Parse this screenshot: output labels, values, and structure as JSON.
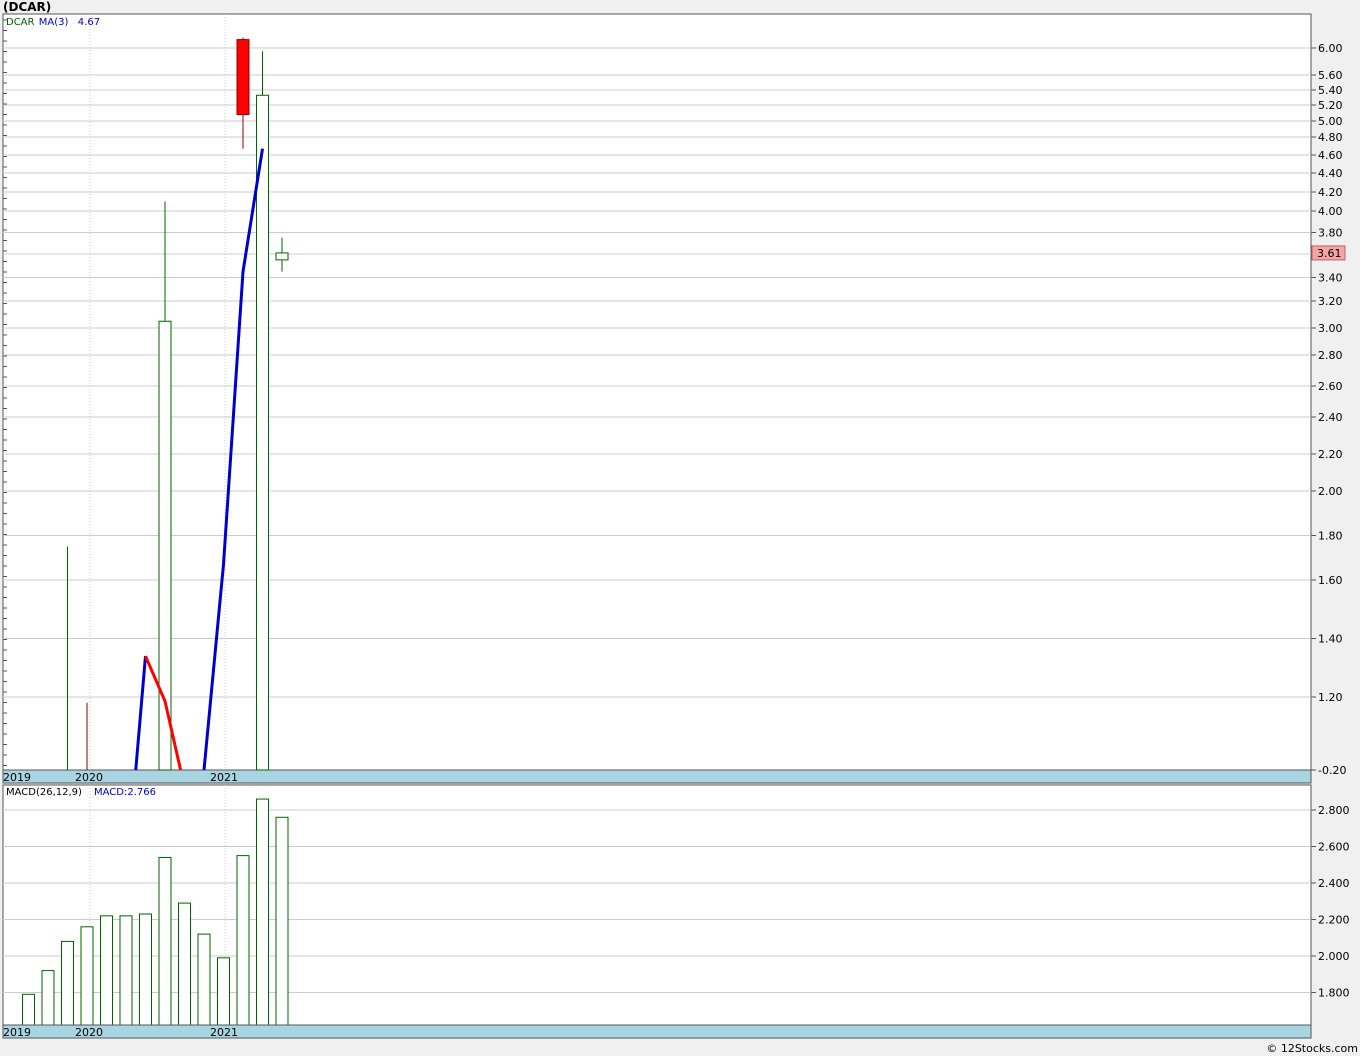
{
  "title": "(DCAR)",
  "credit": "© 12Stocks.com",
  "colors": {
    "background": "#ffffff",
    "axis_band": "#a9d5e3",
    "up": "#006400",
    "down": "#ff0000",
    "ma": "#0000cc",
    "last_price_box": "#f4a6a6",
    "grid": "#cccccc"
  },
  "chart_data": [
    {
      "type": "candlestick",
      "legend": [
        {
          "text": "DCAR",
          "color": "#006400"
        },
        {
          "text": "MA(3)",
          "color": "#0000cc"
        },
        {
          "text": "4.67",
          "color": "#0000cc"
        }
      ],
      "y_ticks": [
        "6.00",
        "5.60",
        "5.40",
        "5.20",
        "5.00",
        "4.80",
        "4.60",
        "4.40",
        "4.20",
        "4.00",
        "3.80",
        "3.60",
        "3.40",
        "3.20",
        "3.00",
        "2.80",
        "2.60",
        "2.40",
        "2.20",
        "2.00",
        "1.80",
        "1.60",
        "1.40",
        "1.20",
        "-0.20"
      ],
      "x_labels": [
        "2019",
        "2020",
        "2021"
      ],
      "last_price": "3.61",
      "candles": [
        {
          "high": 1.75,
          "low": -0.2,
          "open": -0.2,
          "close": -0.2,
          "dir": "up"
        },
        {
          "high": 1.09,
          "low": -0.2,
          "open": -0.2,
          "close": -0.2,
          "dir": "down"
        },
        {
          "high": 4.1,
          "low": -0.2,
          "open": -0.2,
          "close": 3.05,
          "dir": "up"
        },
        {
          "high": 6.15,
          "low": 4.67,
          "open": 6.12,
          "close": 5.08,
          "dir": "down"
        },
        {
          "high": 5.95,
          "low": -0.2,
          "open": -0.2,
          "close": 5.33,
          "dir": "up"
        },
        {
          "high": 3.75,
          "low": 3.45,
          "open": 3.55,
          "close": 3.61,
          "dir": "up"
        }
      ],
      "ma_series": [
        {
          "color": "#0000cc",
          "points": [
            {
              "i": 6.5,
              "v": -0.2
            },
            {
              "i": 7.0,
              "v": 1.34
            }
          ]
        },
        {
          "color": "#ff0000",
          "points": [
            {
              "i": 7.0,
              "v": 1.34
            },
            {
              "i": 8.0,
              "v": 1.12
            },
            {
              "i": 8.8,
              "v": -0.2
            }
          ]
        },
        {
          "color": "#0000cc",
          "points": [
            {
              "i": 10.0,
              "v": -0.2
            },
            {
              "i": 11.0,
              "v": 1.67
            },
            {
              "i": 12.0,
              "v": 3.45
            },
            {
              "i": 13.0,
              "v": 4.67
            }
          ]
        }
      ]
    },
    {
      "type": "bar",
      "legend": [
        {
          "text": "MACD(26,12,9)",
          "color": "#000000"
        },
        {
          "text": "MACD:2.766",
          "color": "#0000cc"
        }
      ],
      "y_ticks": [
        "2.800",
        "2.600",
        "2.400",
        "2.200",
        "2.000",
        "1.800"
      ],
      "x_labels": [
        "2019",
        "2020",
        "2021"
      ],
      "values": [
        1.79,
        1.92,
        2.08,
        2.16,
        2.22,
        2.22,
        2.23,
        2.54,
        2.29,
        2.12,
        1.99,
        2.55,
        2.86,
        2.76
      ]
    }
  ]
}
